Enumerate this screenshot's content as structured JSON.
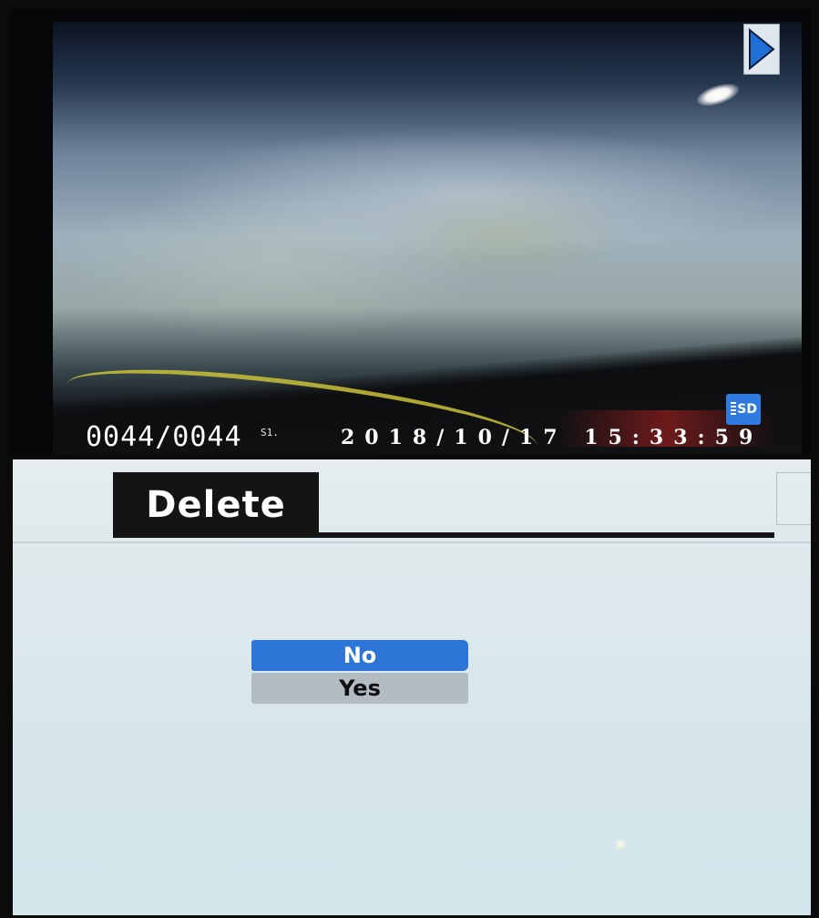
{
  "playback": {
    "counter": "0044/0044",
    "counter_sub": "S1.",
    "timestamp": "2018/10/17  15:33:59",
    "storage_badge": "SD",
    "play_icon": "play-triangle-icon"
  },
  "delete_menu": {
    "title": "Delete",
    "options": [
      {
        "label": "No",
        "selected": true
      },
      {
        "label": "Yes",
        "selected": false
      }
    ]
  },
  "colors": {
    "selection_blue": "#2d76d8",
    "title_bar_black": "#141414",
    "menu_background": "#d6e6ec",
    "unselected_gray": "#b2bcc2"
  }
}
